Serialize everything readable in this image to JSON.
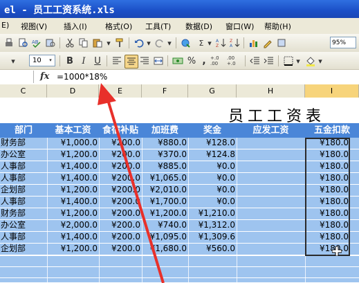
{
  "window": {
    "title": "el - 员工工资系统.xls"
  },
  "menu": {
    "items": [
      "视图(V)",
      "插入(I)",
      "格式(O)",
      "工具(T)",
      "数据(D)",
      "窗口(W)",
      "帮助(H)"
    ],
    "edge": "E)"
  },
  "toolbar": {
    "zoom": "95%",
    "font_size": "10",
    "bold": "B",
    "italic": "I",
    "underline": "U",
    "sum": "Σ",
    "percent": "%",
    "comma": ",",
    "dec_inc": "+.0 .00",
    "dec_dec": ".00 +.0"
  },
  "formula_bar": {
    "fx": "fx",
    "value": "=1000*18%"
  },
  "columns": [
    "C",
    "D",
    "E",
    "F",
    "G",
    "H",
    "I"
  ],
  "sheet": {
    "title": "员工工资表",
    "headers": [
      "部门",
      "基本工资",
      "食宿补贴",
      "加班费",
      "奖金",
      "应发工资",
      "五金扣款"
    ],
    "rows": [
      [
        "财务部",
        "¥1,000.0",
        "¥200.0",
        "¥880.0",
        "¥128.0",
        "",
        "¥180.0"
      ],
      [
        "办公室",
        "¥1,200.0",
        "¥200.0",
        "¥370.0",
        "¥124.8",
        "",
        "¥180.0"
      ],
      [
        "人事部",
        "¥1,400.0",
        "¥200.0",
        "¥885.0",
        "¥0.0",
        "",
        "¥180.0"
      ],
      [
        "人事部",
        "¥1,400.0",
        "¥200.0",
        "¥1,065.0",
        "¥0.0",
        "",
        "¥180.0"
      ],
      [
        "企划部",
        "¥1,200.0",
        "¥200.0",
        "¥2,010.0",
        "¥0.0",
        "",
        "¥180.0"
      ],
      [
        "人事部",
        "¥1,400.0",
        "¥200.0",
        "¥1,700.0",
        "¥0.0",
        "",
        "¥180.0"
      ],
      [
        "财务部",
        "¥1,200.0",
        "¥200.0",
        "¥1,200.0",
        "¥1,210.0",
        "",
        "¥180.0"
      ],
      [
        "办公室",
        "¥2,000.0",
        "¥200.0",
        "¥740.0",
        "¥1,312.0",
        "",
        "¥180.0"
      ],
      [
        "人事部",
        "¥1,400.0",
        "¥200.0",
        "¥1,095.0",
        "¥1,309.6",
        "",
        "¥180.0"
      ],
      [
        "企划部",
        "¥1,200.0",
        "¥200.0",
        "¥1,680.0",
        "¥560.0",
        "",
        "¥180.0"
      ]
    ]
  },
  "colors": {
    "header_blue": "#4a86d8",
    "row_blue": "#9ec4ef",
    "arrow_red": "#e8302a",
    "title_blue": "#1b4fc7"
  }
}
